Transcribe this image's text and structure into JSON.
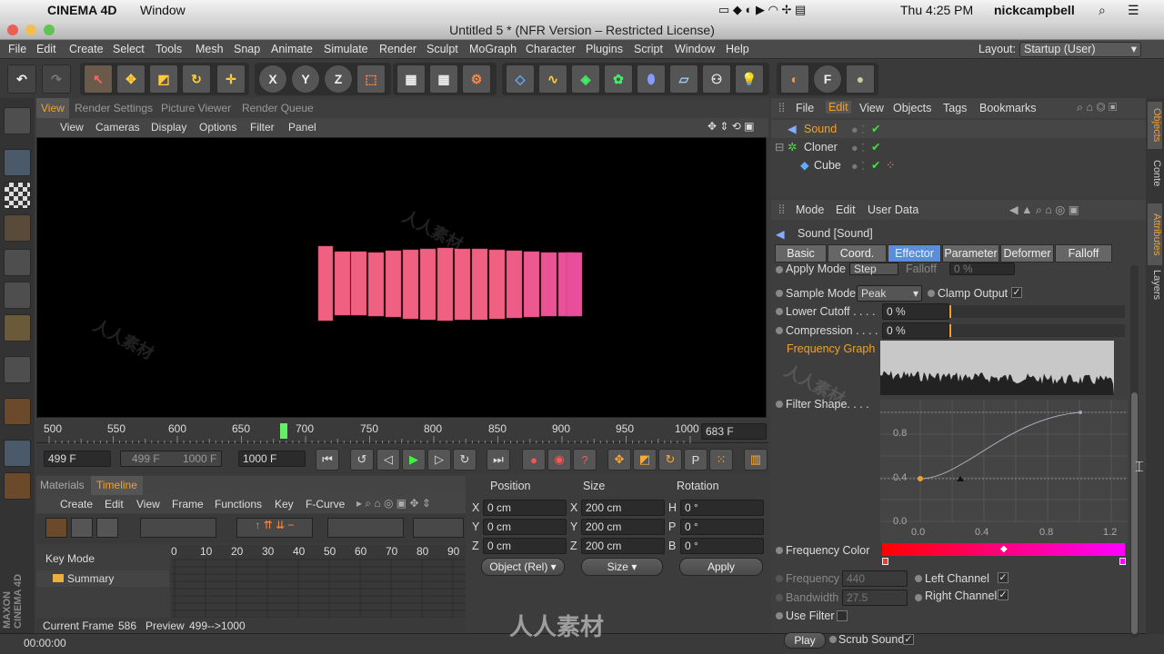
{
  "macbar": {
    "app": "CINEMA 4D",
    "menu": "Window",
    "clock": "Thu 4:25 PM",
    "user": "nickcampbell"
  },
  "window": {
    "title": "Untitled 5 * (NFR Version – Restricted License)"
  },
  "menu": [
    "File",
    "Edit",
    "Create",
    "Select",
    "Tools",
    "Mesh",
    "Snap",
    "Animate",
    "Simulate",
    "Render",
    "Sculpt",
    "MoGraph",
    "Character",
    "Plugins",
    "Script",
    "Window",
    "Help"
  ],
  "layout": {
    "label": "Layout:",
    "value": "Startup (User)"
  },
  "viewport_tabs": [
    "View",
    "Render Settings",
    "Picture Viewer",
    "Render Queue"
  ],
  "viewport_menu": [
    "View",
    "Cameras",
    "Display",
    "Options",
    "Filter",
    "Panel"
  ],
  "ruler": {
    "ticks": [
      "500",
      "550",
      "600",
      "650",
      "700",
      "750",
      "800",
      "850",
      "900",
      "950",
      "1000"
    ],
    "current_frame_field": "683 F"
  },
  "transport": {
    "start": "499 F",
    "range_from": "499 F",
    "range_to": "1000 F",
    "end": "1000 F"
  },
  "timeline": {
    "tabs": [
      "Materials",
      "Timeline"
    ],
    "menu": [
      "Create",
      "Edit",
      "View",
      "Frame",
      "Functions",
      "Key",
      "F-Curve"
    ],
    "key_mode": "Key Mode",
    "summary": "Summary",
    "frames": [
      "0",
      "10",
      "20",
      "30",
      "40",
      "50",
      "60",
      "70",
      "80",
      "90"
    ],
    "current_frame_label": "Current Frame",
    "current_frame": "586",
    "preview_label": "Preview",
    "preview": "499-->1000"
  },
  "coords": {
    "headers": [
      "Position",
      "Size",
      "Rotation"
    ],
    "rows": [
      {
        "axis": "X",
        "pos": "0 cm",
        "saxis": "X",
        "size": "200 cm",
        "raxis": "H",
        "rot": "0 °"
      },
      {
        "axis": "Y",
        "pos": "0 cm",
        "saxis": "Y",
        "size": "200 cm",
        "raxis": "P",
        "rot": "0 °"
      },
      {
        "axis": "Z",
        "pos": "0 cm",
        "saxis": "Z",
        "size": "200 cm",
        "raxis": "B",
        "rot": "0 °"
      }
    ],
    "mode": "Object (Rel)",
    "size_mode": "Size",
    "apply": "Apply"
  },
  "status": {
    "time": "00:00:00"
  },
  "objects": {
    "menu": [
      "File",
      "Edit",
      "View",
      "Objects",
      "Tags",
      "Bookmarks"
    ],
    "items": [
      "Sound",
      "Cloner",
      "Cube"
    ]
  },
  "attributes": {
    "menu": [
      "Mode",
      "Edit",
      "User Data"
    ],
    "title": "Sound [Sound]",
    "tabs": [
      "Basic",
      "Coord.",
      "Effector",
      "Parameter",
      "Deformer",
      "Falloff"
    ],
    "apply_mode_label": "Apply Mode",
    "apply_mode": "Step",
    "falloff_label": "Falloff",
    "falloff": "0 %",
    "sample_mode_label": "Sample Mode",
    "sample_mode": "Peak",
    "clamp_label": "Clamp Output",
    "lower_cutoff_label": "Lower Cutoff . . . .",
    "lower_cutoff": "0 %",
    "compression_label": "Compression . . . .",
    "compression": "0 %",
    "freq_graph_label": "Frequency Graph",
    "filter_shape_label": "Filter Shape. . . .",
    "graph_y": [
      "0.8",
      "0.4",
      "0.0"
    ],
    "graph_x": [
      "0.0",
      "0.4",
      "0.8",
      "1.2"
    ],
    "freq_color_label": "Frequency Color",
    "frequency_label": "Frequency",
    "frequency": "440",
    "bandwidth_label": "Bandwidth",
    "bandwidth": "27.5",
    "left_channel": "Left Channel",
    "right_channel": "Right Channel",
    "use_filter": "Use Filter",
    "play": "Play",
    "scrub": "Scrub Sound"
  },
  "side_tabs": [
    "Objects",
    "Conte",
    "Attributes",
    "Layers"
  ],
  "branding": "MAXON CINEMA 4D",
  "watermark": "人人素材",
  "colors": {
    "accent": "#f0a030",
    "bars": "#f06080",
    "gradient_start": "#ff0000",
    "gradient_end": "#ff00ff"
  }
}
